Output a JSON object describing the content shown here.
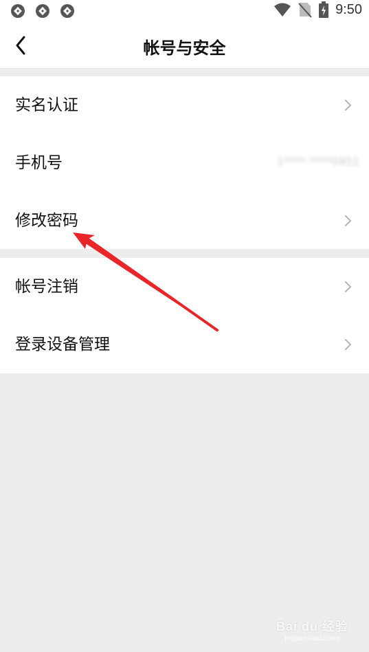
{
  "status_bar": {
    "time": "9:50",
    "icons": [
      "app-notification-icon",
      "app-notification-icon",
      "app-notification-icon",
      "wifi-icon",
      "no-sim-icon",
      "battery-charging-icon"
    ]
  },
  "nav": {
    "title": "帐号与安全",
    "back_icon": "chevron-left-icon"
  },
  "settings": {
    "group1": [
      {
        "label": "实名认证",
        "chevron": true
      },
      {
        "label": "手机号",
        "value": "1**** ****0451",
        "chevron": true
      },
      {
        "label": "修改密码",
        "chevron": true
      }
    ],
    "group2": [
      {
        "label": "帐号注销",
        "chevron": true
      },
      {
        "label": "登录设备管理",
        "chevron": true
      }
    ]
  },
  "annotation": {
    "color": "#e8262a",
    "target": "修改密码"
  },
  "watermark": {
    "main": "Bai du 经验",
    "sub": "jingyan.baidu.com"
  },
  "colors": {
    "background": "#ededed",
    "surface": "#ffffff",
    "text": "#111111",
    "chevron": "#b3b3b3"
  }
}
